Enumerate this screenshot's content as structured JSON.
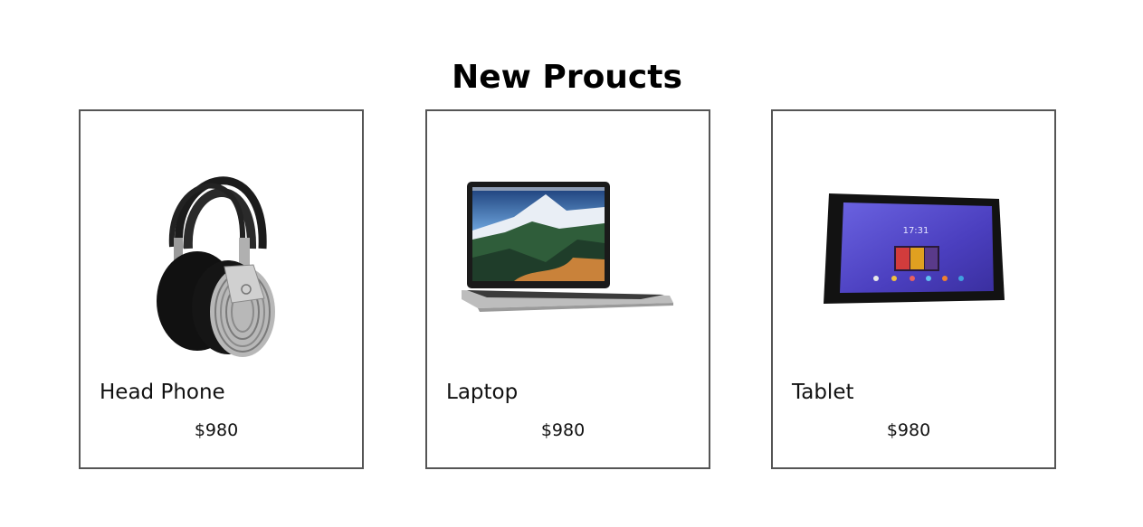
{
  "heading": "New Proucts",
  "products": [
    {
      "name": "Head Phone",
      "price": "$980",
      "icon": "headphone-image"
    },
    {
      "name": "Laptop",
      "price": "$980",
      "icon": "laptop-image"
    },
    {
      "name": "Tablet",
      "price": "$980",
      "icon": "tablet-image"
    }
  ],
  "tablet_screen": {
    "clock": "17:31"
  },
  "colors": {
    "card_border": "#555555",
    "text": "#111111",
    "tablet_screen": "#4b3fbf"
  }
}
